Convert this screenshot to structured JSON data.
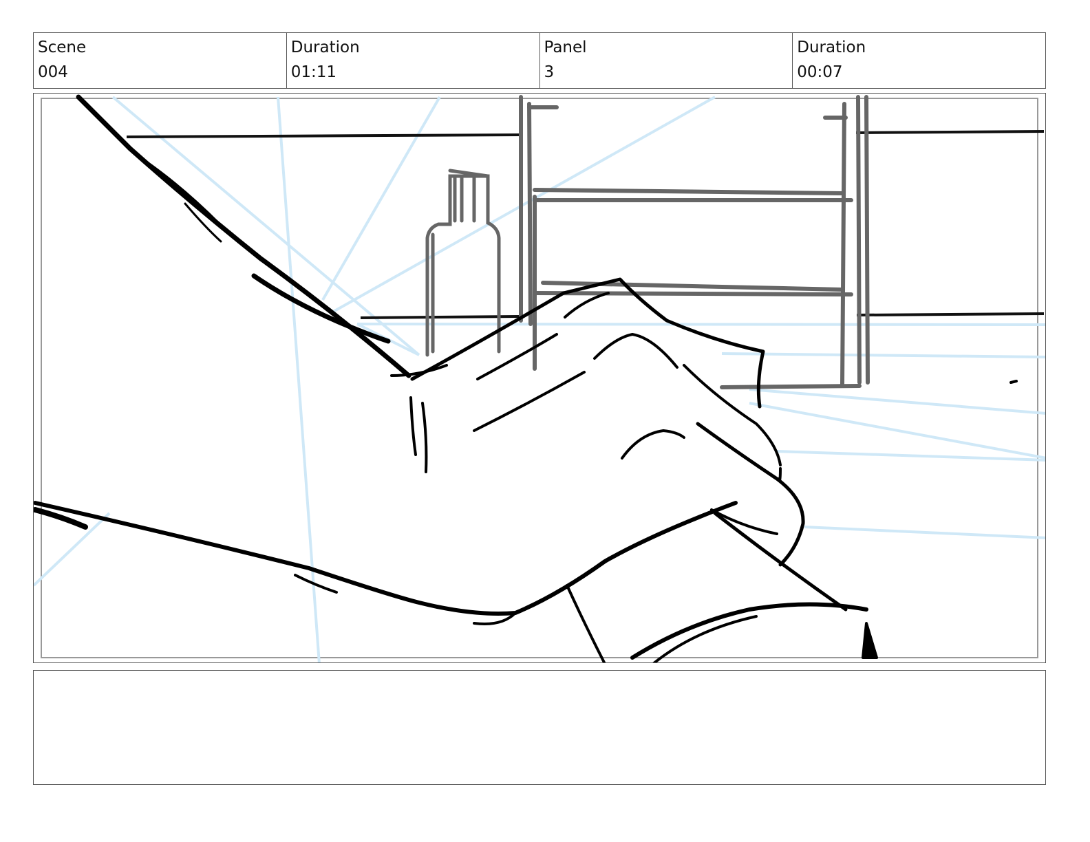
{
  "header": {
    "scene_label": "Scene",
    "scene_value": "004",
    "scene_duration_label": "Duration",
    "scene_duration_value": "01:11",
    "panel_label": "Panel",
    "panel_value": "3",
    "panel_duration_label": "Duration",
    "panel_duration_value": "00:07"
  },
  "panel": {
    "sketch_subject": "hand-reaching-over-shelf-sketch",
    "guide_color": "#cfe8f7",
    "ink_color": "#000000",
    "shelf_color": "#666666"
  },
  "notes": {
    "text": ""
  }
}
